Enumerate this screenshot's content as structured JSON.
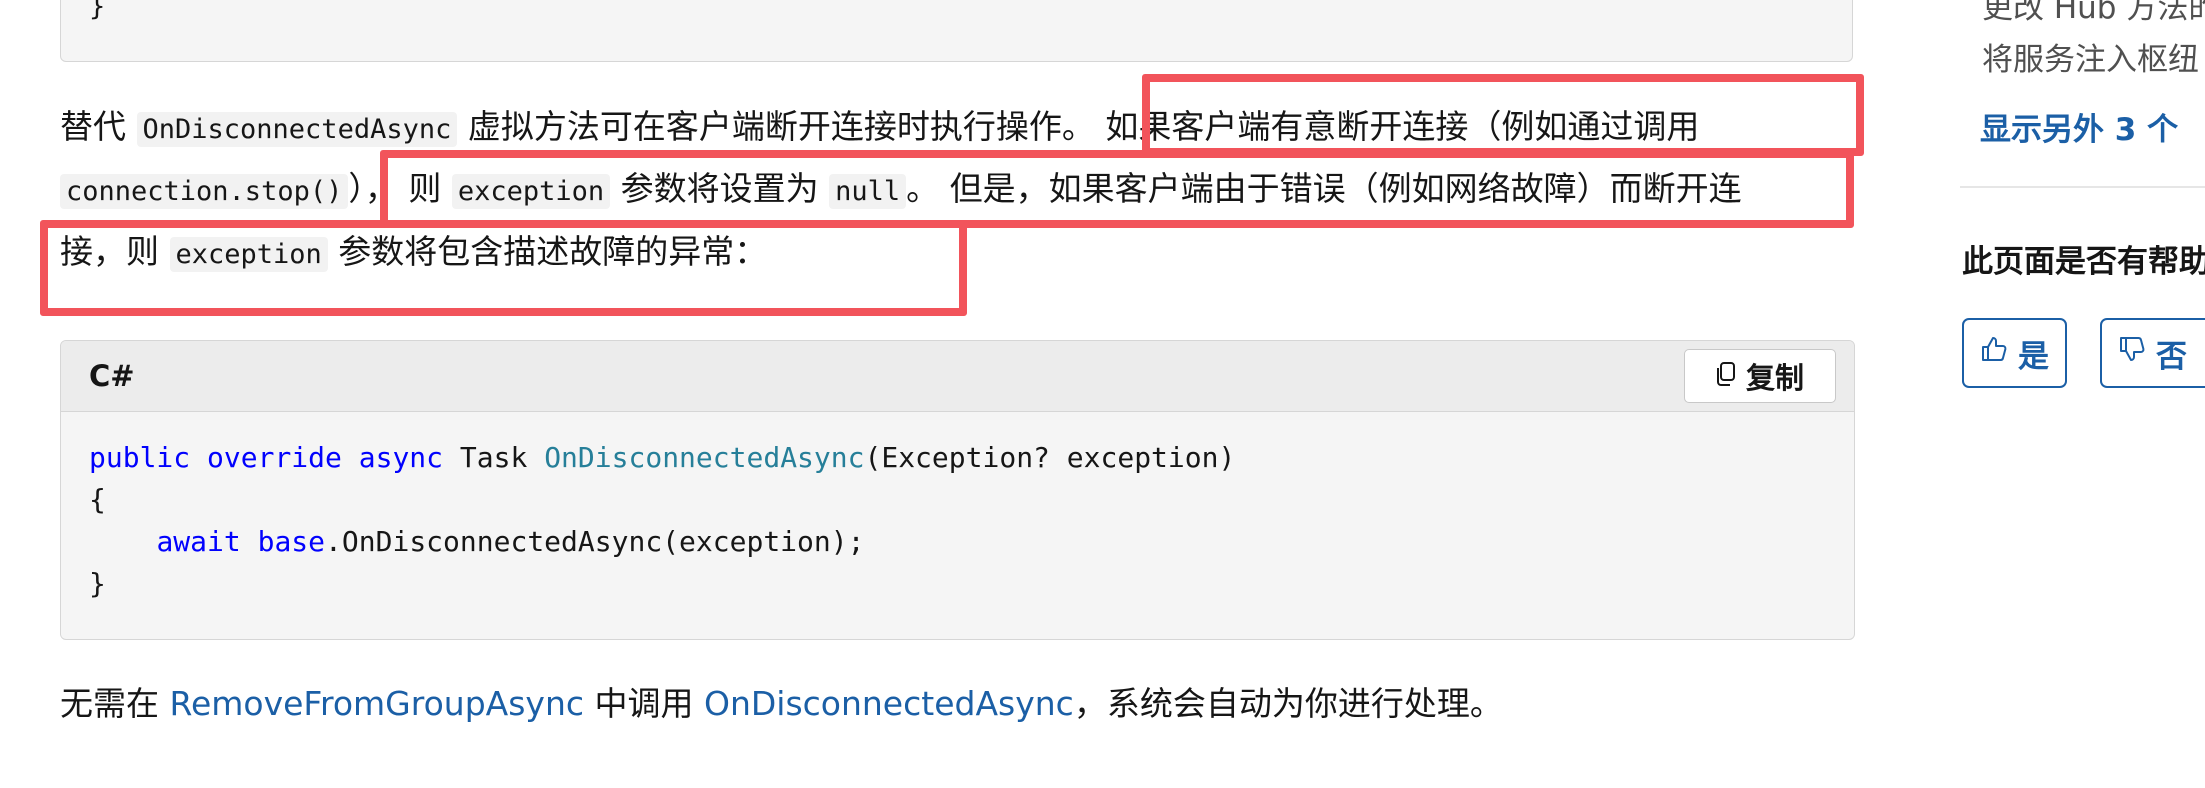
{
  "top_code": {
    "closing_brace": "}"
  },
  "paragraph1": {
    "line1_a": "替代 ",
    "line1_code": "OnDisconnectedAsync",
    "line1_b": " 虚拟方法可在客户端断开连接时执行操作。 如果客户端有意断开连接（例如通过调用",
    "line2_code1": "connection.stop()",
    "line2_a": "）， 则 ",
    "line2_code2": "exception",
    "line2_b": " 参数将设置为 ",
    "line2_code3": "null",
    "line2_c": "。 但是，如果客户端由于错误（例如网络故障）而断开连",
    "line3_a": "接，则 ",
    "line3_code": "exception",
    "line3_b": " 参数将包含描述故障的异常："
  },
  "code_card": {
    "language": "C#",
    "copy_label": "复制",
    "line1": {
      "kw1": "public",
      "kw2": "override",
      "kw3": "async",
      "type": "Task",
      "method": "OnDisconnectedAsync",
      "params": "(Exception? exception)"
    },
    "line2": "{",
    "line3": {
      "kw1": "await",
      "kw2": "base",
      "rest": ".OnDisconnectedAsync(exception);"
    },
    "line4": "}"
  },
  "paragraph2": {
    "a": "无需在 ",
    "link1": "RemoveFromGroupAsync",
    "b": " 中调用 ",
    "link2": "OnDisconnectedAsync",
    "c": "，系统会自动为你进行处理。"
  },
  "sidebar": {
    "item_top_partial": "更改 Hub 方法的",
    "item_inject": "将服务注入枢纽",
    "show_more": "显示另外 3 个",
    "feedback_title": "此页面是否有帮助",
    "yes_label": "是",
    "no_label": "否"
  },
  "colors": {
    "highlight": "#f2545b",
    "link": "#1b5fa6",
    "keyword": "#0101fd",
    "method": "#267f99"
  }
}
